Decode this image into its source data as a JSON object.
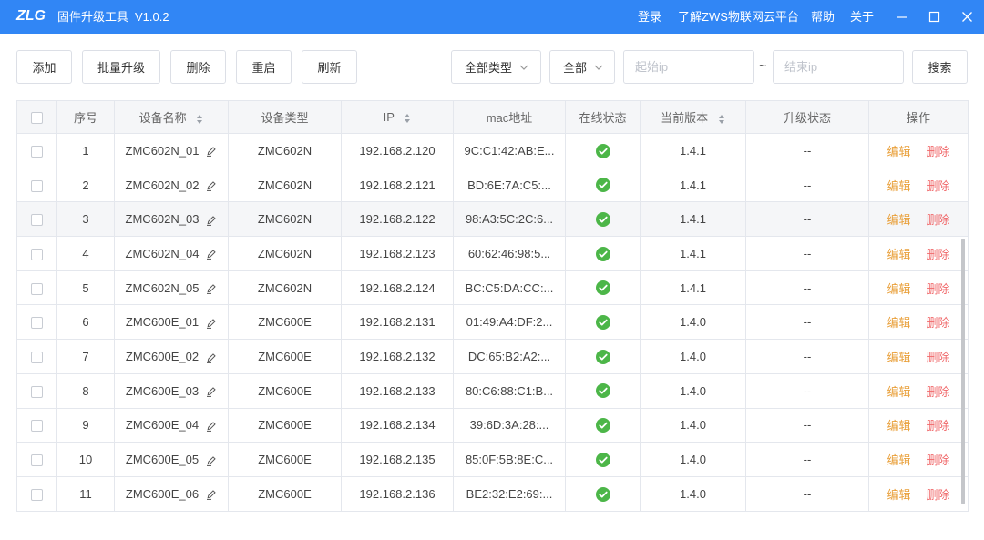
{
  "titlebar": {
    "logo": "ZLG",
    "app_name": "固件升级工具",
    "version": "V1.0.2",
    "login": "登录",
    "zws_cloud": "了解ZWS物联网云平台",
    "help": "帮助",
    "about": "关于",
    "window_controls": [
      "minimize-icon",
      "maximize-icon",
      "close-icon"
    ]
  },
  "toolbar": {
    "add": "添加",
    "batch_upgrade": "批量升级",
    "delete": "删除",
    "restart": "重启",
    "refresh": "刷新",
    "type_filter": "全部类型",
    "status_filter": "全部",
    "dropdown_icon": "chevron-down-icon",
    "start_ip": {
      "value": "",
      "placeholder": "起始ip"
    },
    "range_separator": "~",
    "end_ip": {
      "value": "",
      "placeholder": "结束ip"
    },
    "search": "搜索"
  },
  "table": {
    "columns": [
      {
        "label": "",
        "sortable": false
      },
      {
        "label": "序号",
        "sortable": false
      },
      {
        "label": "设备名称",
        "sortable": true
      },
      {
        "label": "设备类型",
        "sortable": false
      },
      {
        "label": "IP",
        "sortable": true
      },
      {
        "label": "mac地址",
        "sortable": false
      },
      {
        "label": "在线状态",
        "sortable": false
      },
      {
        "label": "当前版本",
        "sortable": true
      },
      {
        "label": "升级状态",
        "sortable": false
      },
      {
        "label": "操作",
        "sortable": false
      }
    ],
    "actions": {
      "edit": "编辑",
      "delete": "删除"
    },
    "rows": [
      {
        "index": 1,
        "name": "ZMC602N_01",
        "type": "ZMC602N",
        "ip": "192.168.2.120",
        "mac": "9C:C1:42:AB:E...",
        "online": true,
        "version": "1.4.1",
        "upgrade_status": "--"
      },
      {
        "index": 2,
        "name": "ZMC602N_02",
        "type": "ZMC602N",
        "ip": "192.168.2.121",
        "mac": "BD:6E:7A:C5:...",
        "online": true,
        "version": "1.4.1",
        "upgrade_status": "--"
      },
      {
        "index": 3,
        "name": "ZMC602N_03",
        "type": "ZMC602N",
        "ip": "192.168.2.122",
        "mac": "98:A3:5C:2C:6...",
        "online": true,
        "version": "1.4.1",
        "upgrade_status": "--"
      },
      {
        "index": 4,
        "name": "ZMC602N_04",
        "type": "ZMC602N",
        "ip": "192.168.2.123",
        "mac": "60:62:46:98:5...",
        "online": true,
        "version": "1.4.1",
        "upgrade_status": "--"
      },
      {
        "index": 5,
        "name": "ZMC602N_05",
        "type": "ZMC602N",
        "ip": "192.168.2.124",
        "mac": "BC:C5:DA:CC:...",
        "online": true,
        "version": "1.4.1",
        "upgrade_status": "--"
      },
      {
        "index": 6,
        "name": "ZMC600E_01",
        "type": "ZMC600E",
        "ip": "192.168.2.131",
        "mac": "01:49:A4:DF:2...",
        "online": true,
        "version": "1.4.0",
        "upgrade_status": "--"
      },
      {
        "index": 7,
        "name": "ZMC600E_02",
        "type": "ZMC600E",
        "ip": "192.168.2.132",
        "mac": "DC:65:B2:A2:...",
        "online": true,
        "version": "1.4.0",
        "upgrade_status": "--"
      },
      {
        "index": 8,
        "name": "ZMC600E_03",
        "type": "ZMC600E",
        "ip": "192.168.2.133",
        "mac": "80:C6:88:C1:B...",
        "online": true,
        "version": "1.4.0",
        "upgrade_status": "--"
      },
      {
        "index": 9,
        "name": "ZMC600E_04",
        "type": "ZMC600E",
        "ip": "192.168.2.134",
        "mac": "39:6D:3A:28:...",
        "online": true,
        "version": "1.4.0",
        "upgrade_status": "--"
      },
      {
        "index": 10,
        "name": "ZMC600E_05",
        "type": "ZMC600E",
        "ip": "192.168.2.135",
        "mac": "85:0F:5B:8E:C...",
        "online": true,
        "version": "1.4.0",
        "upgrade_status": "--"
      },
      {
        "index": 11,
        "name": "ZMC600E_06",
        "type": "ZMC600E",
        "ip": "192.168.2.136",
        "mac": "BE2:32:E2:69:...",
        "online": true,
        "version": "1.4.0",
        "upgrade_status": "--"
      }
    ]
  },
  "icons": {
    "edit_name": "pencil-icon",
    "online": "check-circle-icon",
    "sort": "sort-icon",
    "row_select": "checkbox"
  },
  "colors": {
    "title_bar": "#3186f5",
    "edit_action": "#e9a03b",
    "delete_action": "#f0696b",
    "online": "#4cb648",
    "row_hover": "#f5f6f8"
  }
}
